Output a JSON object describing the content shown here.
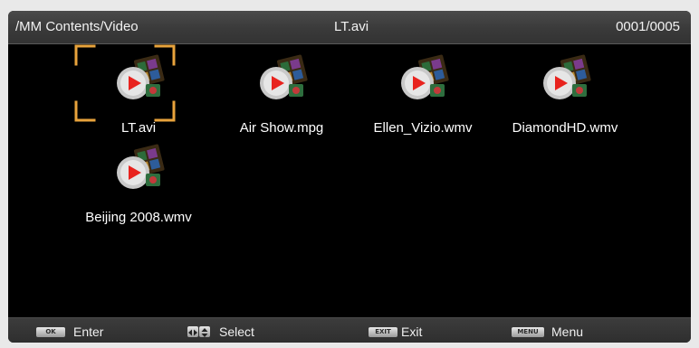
{
  "header": {
    "path": "/MM Contents/Video",
    "selected_title": "LT.avi",
    "counter": "0001/0005"
  },
  "files": [
    {
      "label": "LT.avi",
      "icon": "video-file-icon",
      "focused": true
    },
    {
      "label": "Air Show.mpg",
      "icon": "video-file-icon",
      "focused": false
    },
    {
      "label": "Ellen_Vizio.wmv",
      "icon": "video-file-icon",
      "focused": false
    },
    {
      "label": "DiamondHD.wmv",
      "icon": "video-file-icon",
      "focused": false
    },
    {
      "label": "Beijing 2008.wmv",
      "icon": "video-file-icon",
      "focused": false
    }
  ],
  "footer": {
    "enter": {
      "key": "OK",
      "label": "Enter"
    },
    "select": {
      "key": "arrows",
      "label": "Select"
    },
    "exit": {
      "key": "EXIT",
      "label": "Exit"
    },
    "menu": {
      "key": "MENU",
      "label": "Menu"
    }
  },
  "colors": {
    "focus_bracket": "#e8a33c",
    "background": "#000000",
    "play_triangle": "#e8231e"
  }
}
